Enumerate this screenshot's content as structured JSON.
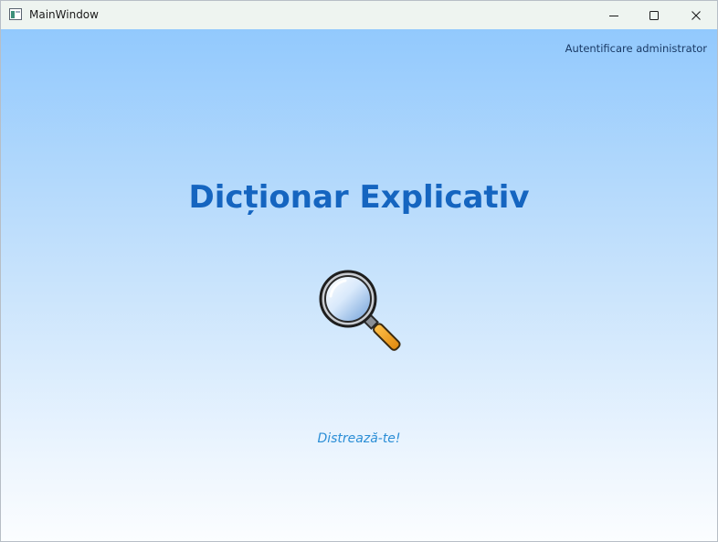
{
  "window": {
    "title": "MainWindow",
    "app_icon": "window-app-icon",
    "caption_buttons": {
      "minimize_icon": "minimize-icon",
      "maximize_icon": "maximize-icon",
      "close_icon": "close-icon"
    }
  },
  "header": {
    "admin_link": "Autentificare administrator"
  },
  "main": {
    "title": "Dicționar Explicativ",
    "search_icon": "magnifier-icon",
    "tagline": "Distrează-te!"
  },
  "colors": {
    "title": "#1565c0",
    "tagline": "#2b8ed6",
    "gradient_top": "#92c9fd",
    "gradient_bottom": "#fbfdff",
    "magnifier_handle": "#f5a020"
  }
}
